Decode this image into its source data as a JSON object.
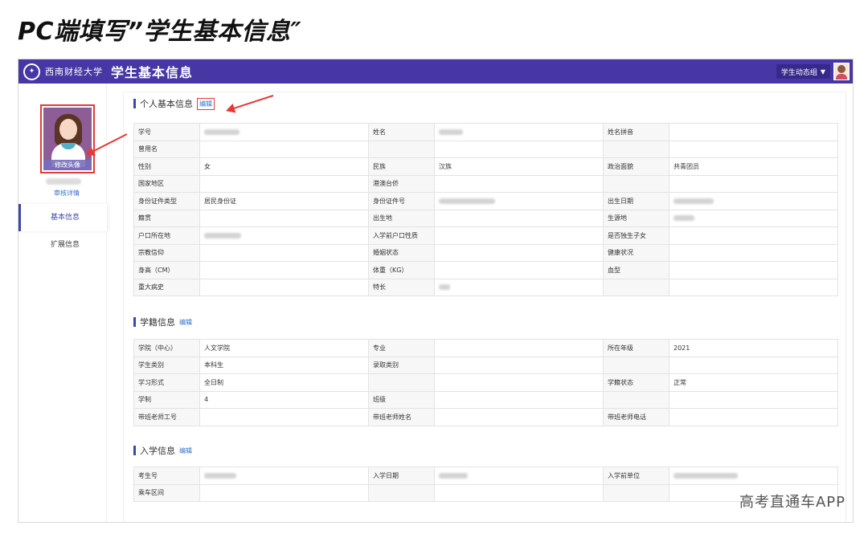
{
  "caption": "PC端填写”学生基本信息″",
  "header": {
    "logo_icon": "university-seal-icon",
    "university_name": "西南财经大学",
    "title": "学生基本信息",
    "group_selector": "学生动态组",
    "theme_color": "#4637a5"
  },
  "sidebar": {
    "change_photo_label": "修改头像",
    "audit_link": "审核详情",
    "nav": [
      {
        "label": "基本信息",
        "active": true
      },
      {
        "label": "扩展信息",
        "active": false
      }
    ]
  },
  "sections": {
    "personal": {
      "title": "个人基本信息",
      "edit_label": "编辑",
      "rows": [
        [
          {
            "label": "学号",
            "value": ""
          },
          {
            "label": "姓名",
            "value": ""
          },
          {
            "label": "姓名拼音",
            "value": ""
          }
        ],
        [
          {
            "label": "曾用名",
            "value": ""
          }
        ],
        [
          {
            "label": "性别",
            "value": "女"
          },
          {
            "label": "民族",
            "value": "汉族"
          },
          {
            "label": "政治面貌",
            "value": "共青团员"
          }
        ],
        [
          {
            "label": "国家地区",
            "value": ""
          },
          {
            "label": "港澳台侨",
            "value": ""
          }
        ],
        [
          {
            "label": "身份证件类型",
            "value": "居民身份证"
          },
          {
            "label": "身份证件号",
            "value": ""
          },
          {
            "label": "出生日期",
            "value": ""
          }
        ],
        [
          {
            "label": "籍贯",
            "value": ""
          },
          {
            "label": "出生地",
            "value": ""
          },
          {
            "label": "生源地",
            "value": ""
          }
        ],
        [
          {
            "label": "户口所在地",
            "value": ""
          },
          {
            "label": "入学前户口性质",
            "value": ""
          },
          {
            "label": "是否独生子女",
            "value": ""
          }
        ],
        [
          {
            "label": "宗教信仰",
            "value": ""
          },
          {
            "label": "婚姻状态",
            "value": ""
          },
          {
            "label": "健康状况",
            "value": ""
          }
        ],
        [
          {
            "label": "身高（CM）",
            "value": ""
          },
          {
            "label": "体重（KG）",
            "value": ""
          },
          {
            "label": "血型",
            "value": ""
          }
        ],
        [
          {
            "label": "重大病史",
            "value": ""
          },
          {
            "label": "特长",
            "value": ""
          }
        ]
      ]
    },
    "enrollment": {
      "title": "学籍信息",
      "edit_label": "编辑",
      "rows": [
        [
          {
            "label": "学院（中心）",
            "value": "人文学院"
          },
          {
            "label": "专业",
            "value": ""
          },
          {
            "label": "所在年级",
            "value": "2021"
          }
        ],
        [
          {
            "label": "学生类别",
            "value": "本科生"
          },
          {
            "label": "录取类别",
            "value": ""
          }
        ],
        [
          {
            "label": "学习形式",
            "value": "全日制"
          },
          {
            "label": "",
            "value": ""
          },
          {
            "label": "学籍状态",
            "value": "正常"
          }
        ],
        [
          {
            "label": "学制",
            "value": "4"
          },
          {
            "label": "班级",
            "value": ""
          }
        ],
        [
          {
            "label": "带班老师工号",
            "value": ""
          },
          {
            "label": "带班老师姓名",
            "value": ""
          },
          {
            "label": "带班老师电话",
            "value": ""
          }
        ]
      ]
    },
    "admission": {
      "title": "入学信息",
      "edit_label": "编辑",
      "rows": [
        [
          {
            "label": "考生号",
            "value": ""
          },
          {
            "label": "入学日期",
            "value": ""
          },
          {
            "label": "入学前单位",
            "value": ""
          }
        ],
        [
          {
            "label": "乘车区间",
            "value": ""
          }
        ]
      ]
    }
  },
  "watermark": "高考直通车APP",
  "annotation_color": "#e53935"
}
